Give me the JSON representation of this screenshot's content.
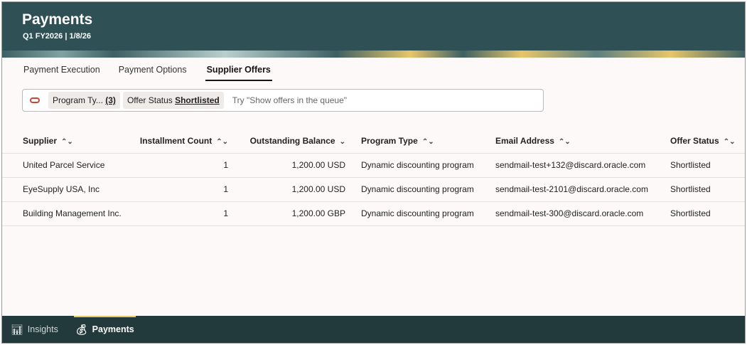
{
  "header": {
    "title": "Payments",
    "subtitle": "Q1 FY2026 | 1/8/26"
  },
  "tabs": [
    {
      "label": "Payment Execution"
    },
    {
      "label": "Payment Options"
    },
    {
      "label": "Supplier Offers"
    }
  ],
  "search": {
    "chips": [
      {
        "label": "Program Ty...",
        "value": "(3)"
      },
      {
        "label": "Offer Status",
        "value": "Shortlisted"
      }
    ],
    "placeholder": "Try \"Show offers in the queue\""
  },
  "table": {
    "columns": [
      "Supplier",
      "Installment Count",
      "Outstanding Balance",
      "Program Type",
      "Email Address",
      "Offer Status"
    ],
    "rows": [
      [
        "United Parcel Service",
        "1",
        "1,200.00 USD",
        "Dynamic discounting program",
        "sendmail-test+132@discard.oracle.com",
        "Shortlisted"
      ],
      [
        "EyeSupply USA, Inc",
        "1",
        "1,200.00 USD",
        "Dynamic discounting program",
        "sendmail-test-2101@discard.oracle.com",
        "Shortlisted"
      ],
      [
        "Building Management Inc.",
        "1",
        "1,200.00 GBP",
        "Dynamic discounting program",
        "sendmail-test-300@discard.oracle.com",
        "Shortlisted"
      ]
    ]
  },
  "nav": [
    {
      "label": "Insights",
      "icon": "bar-chart-icon"
    },
    {
      "label": "Payments",
      "icon": "payments-icon"
    }
  ]
}
